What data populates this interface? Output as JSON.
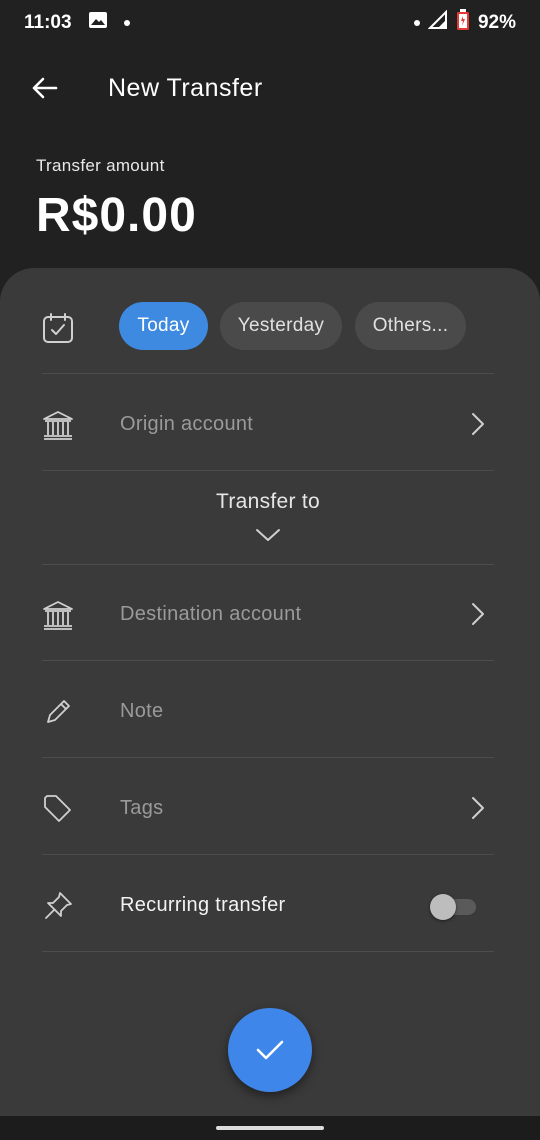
{
  "status_bar": {
    "time": "11:03",
    "battery": "92%",
    "icons": [
      "image-icon",
      "dot-icon",
      "signal-icon",
      "battery-icon"
    ]
  },
  "header": {
    "title": "New Transfer",
    "back_icon": "arrow-left-icon"
  },
  "amount": {
    "label": "Transfer amount",
    "value": "R$0.00"
  },
  "date": {
    "icon": "calendar-check-icon",
    "chips": [
      "Today",
      "Yesterday",
      "Others..."
    ],
    "selected": "Today"
  },
  "origin": {
    "icon": "bank-icon",
    "placeholder": "Origin account"
  },
  "transfer_to": {
    "label": "Transfer to",
    "icon": "chevron-down-icon"
  },
  "destination": {
    "icon": "bank-icon",
    "placeholder": "Destination account"
  },
  "note": {
    "icon": "pencil-icon",
    "placeholder": "Note"
  },
  "tags": {
    "icon": "tag-icon",
    "placeholder": "Tags"
  },
  "recurring": {
    "icon": "pin-icon",
    "label": "Recurring transfer",
    "enabled": false
  },
  "fab": {
    "icon": "check-icon"
  },
  "colors": {
    "background": "#212121",
    "sheet": "#3a3a3a",
    "accent": "#3e8ae0",
    "chip": "#4a4a4a"
  }
}
